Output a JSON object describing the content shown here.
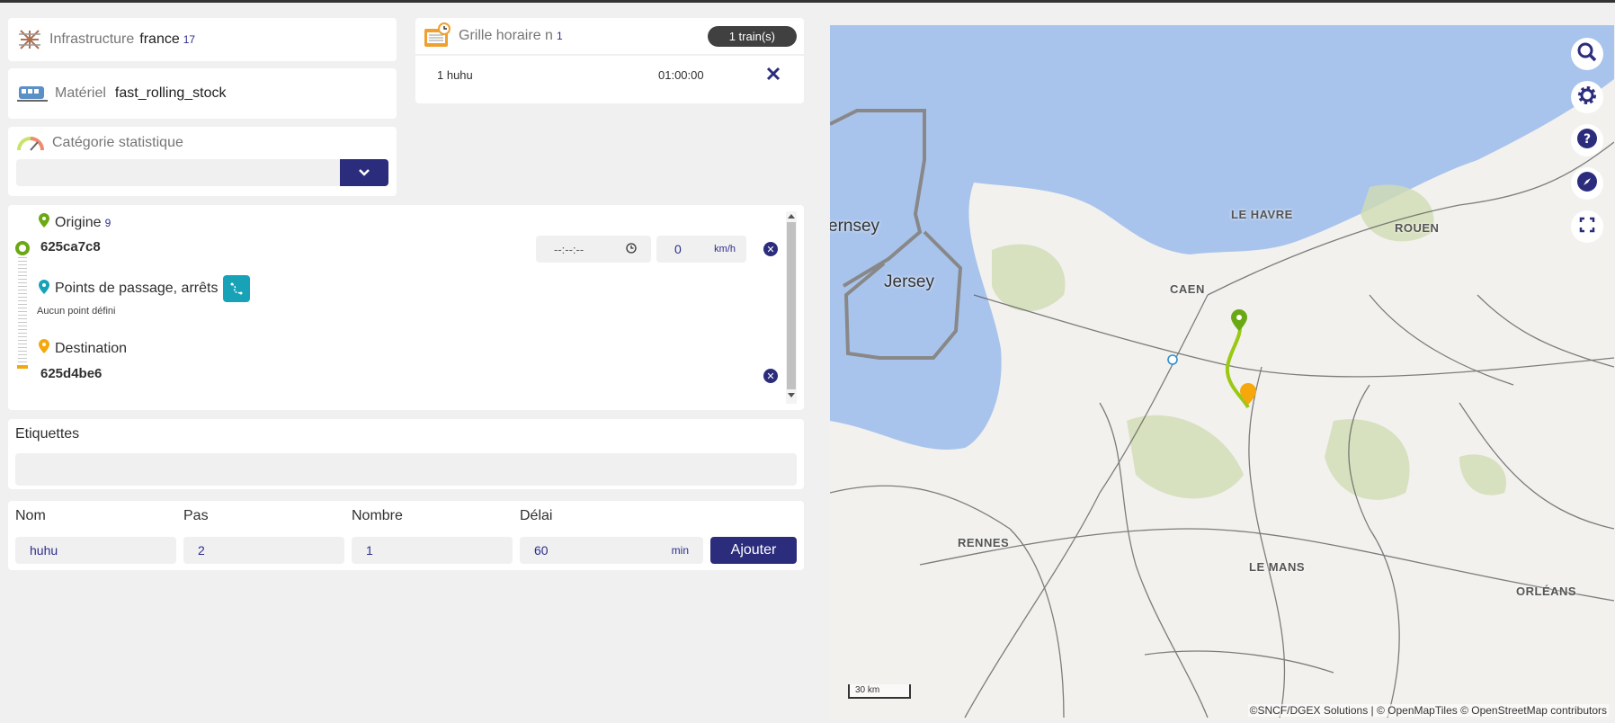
{
  "infra": {
    "label": "Infrastructure",
    "name": "france",
    "id": "17"
  },
  "materiel": {
    "label": "Matériel",
    "name": "fast_rolling_stock"
  },
  "categorie": {
    "label": "Catégorie statistique"
  },
  "grille": {
    "label": "Grille horaire n",
    "count": "1",
    "badge": "1 train(s)",
    "train_name": "1 huhu",
    "train_time": "01:00:00"
  },
  "itinerary": {
    "origin_label": "Origine",
    "origin_count": "9",
    "origin_id": "625ca7c8",
    "time_placeholder": "--:--:--",
    "speed_value": "0",
    "speed_unit": "km/h",
    "waypoints_label": "Points de passage, arrêts",
    "waypoints_empty": "Aucun point défini",
    "destination_label": "Destination",
    "destination_id": "625d4be6"
  },
  "etiquettes": {
    "label": "Etiquettes"
  },
  "form": {
    "nom_label": "Nom",
    "nom_value": "huhu",
    "pas_label": "Pas",
    "pas_value": "2",
    "nombre_label": "Nombre",
    "nombre_value": "1",
    "delai_label": "Délai",
    "delai_value": "60",
    "delai_unit": "min",
    "submit": "Ajouter"
  },
  "map": {
    "cities": [
      "LE HAVRE",
      "ROUEN",
      "CAEN",
      "RENNES",
      "LE MANS",
      "ORLÉANS"
    ],
    "islands": [
      "Jersey",
      "ernsey"
    ],
    "scale": "30 km",
    "attribution": "©SNCF/DGEX Solutions | © OpenMapTiles © OpenStreetMap contributors",
    "controls": [
      "search-icon",
      "gear-icon",
      "help-icon",
      "compass-icon",
      "fullscreen-icon"
    ]
  },
  "colors": {
    "accent": "#2c2c7d",
    "route": "#9ac813",
    "origin_pin": "#6aa814",
    "dest_pin": "#f5a70c",
    "waypoint_btn": "#17a2b8"
  }
}
